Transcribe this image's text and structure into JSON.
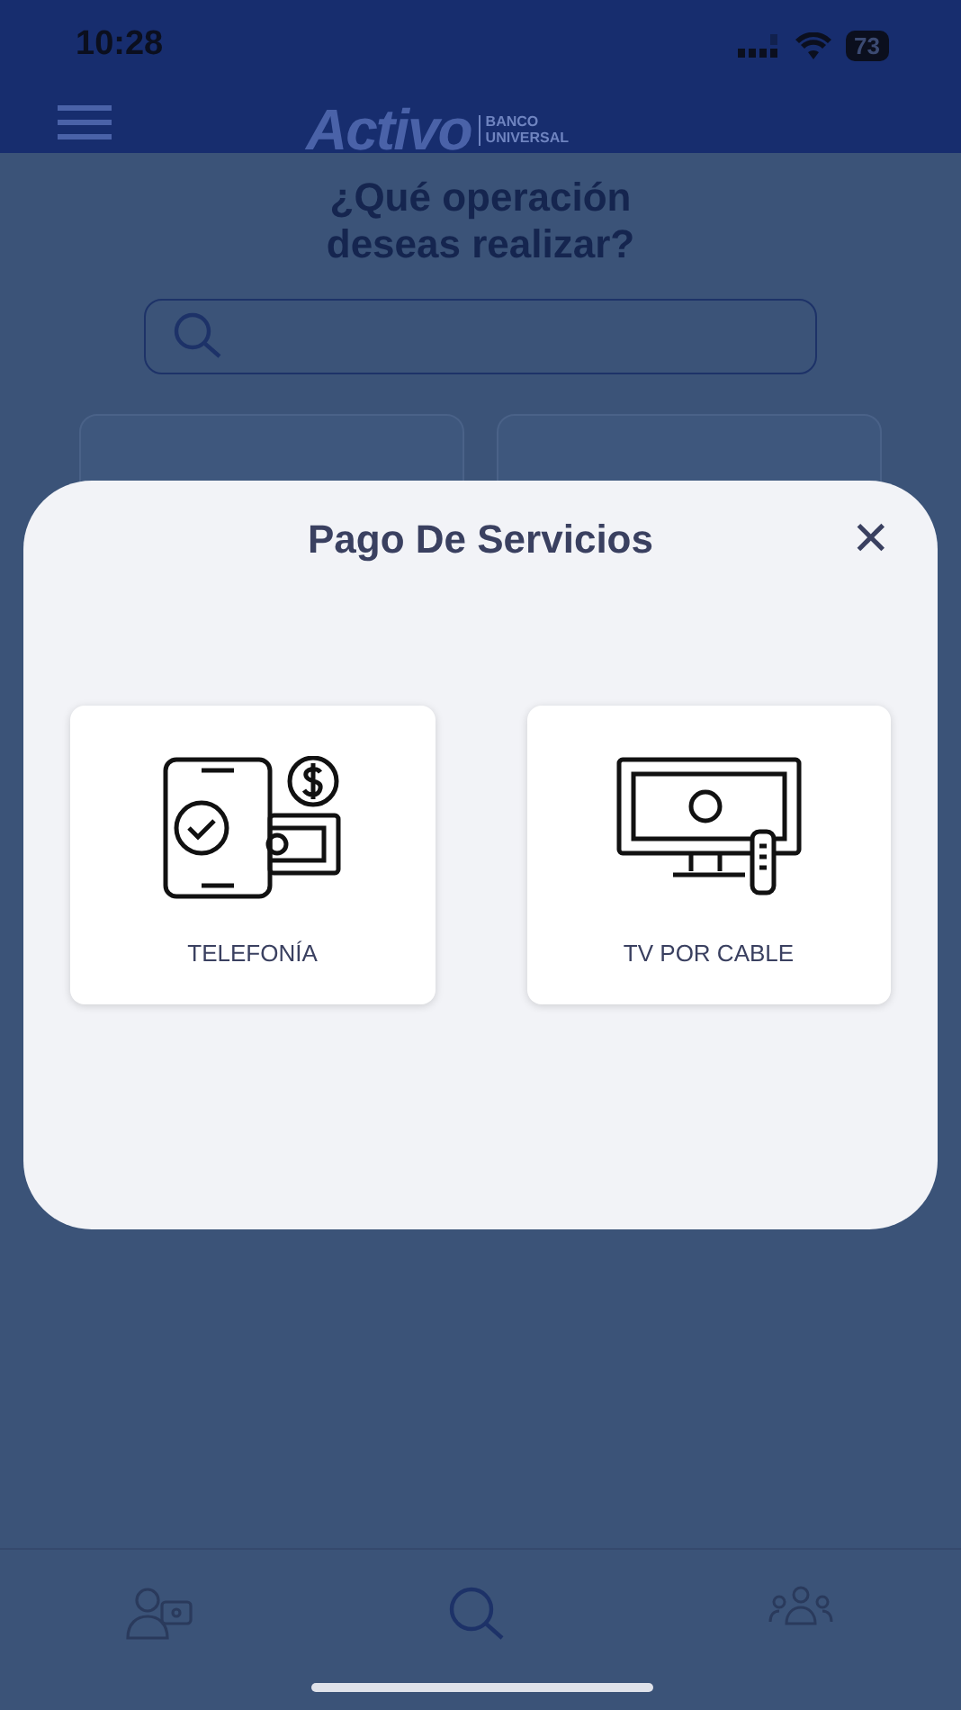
{
  "status_bar": {
    "time": "10:28",
    "battery": "73"
  },
  "header": {
    "logo": "Activo",
    "logo_subtitle": [
      "BANCO",
      "UNIVERSAL"
    ]
  },
  "page": {
    "title": "¿Qué operación deseas realizar?"
  },
  "modal": {
    "title": "Pago De Servicios",
    "close": "✕",
    "options": [
      {
        "kind": "phone",
        "label": "TELEFONÍA"
      },
      {
        "kind": "tv",
        "label": "TV POR CABLE"
      }
    ]
  },
  "bottom_nav": [
    {
      "kind": "account",
      "selected": false
    },
    {
      "kind": "search",
      "selected": true
    },
    {
      "kind": "group",
      "selected": false
    }
  ]
}
